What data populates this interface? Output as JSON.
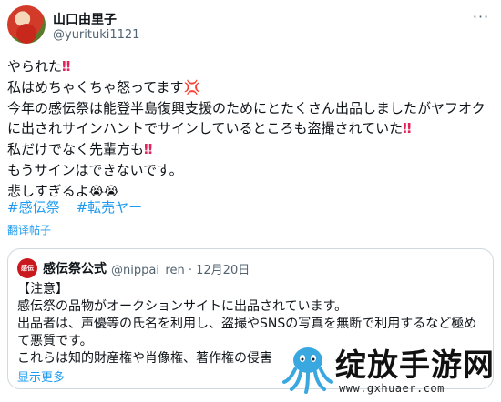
{
  "author": {
    "name": "山口由里子",
    "handle": "@yurituki1121"
  },
  "tweet": {
    "lines": [
      "やられた",
      "私はめちゃくちゃ怒ってます",
      "今年の感伝祭は能登半島復興支援のためにとたくさん出品しましたがヤフオクに出されサインハントでサインしているところも盗撮されていた",
      "私だけでなく先輩方も",
      "もうサインはできないです。",
      "悲しすぎるよ"
    ],
    "emoji": {
      "exclaim": "‼",
      "anger": "💢",
      "cry": "😭😭"
    },
    "hashtags": [
      "#感伝祭",
      "#転売ヤー"
    ],
    "translate_label": "翻译帖子"
  },
  "quote": {
    "avatar_text": "感伝",
    "name": "感伝祭公式",
    "meta": "@nippai_ren · 12月20日",
    "body": [
      "【注意】",
      "感伝祭の品物がオークションサイトに出品されています。",
      "出品者は、声優等の氏名を利用し、盗撮やSNSの写真を無断で利用するなど極めて悪質です。",
      "これらは知的財産権や肖像権、著作権の侵害"
    ],
    "show_more": "显示更多"
  },
  "watermark": {
    "title": "绽放手游网",
    "url": "www.gxhuaer.com"
  },
  "colors": {
    "link": "#1d9bf0",
    "text": "#0f1419",
    "muted": "#536471",
    "border": "#cfd9de"
  }
}
